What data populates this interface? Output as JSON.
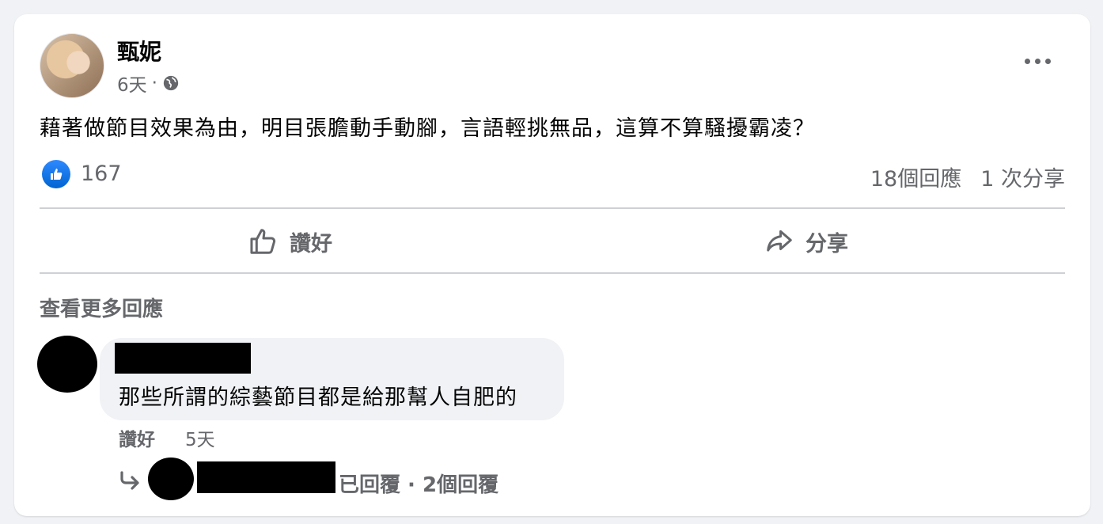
{
  "post": {
    "author": "甄妮",
    "time": "6天",
    "separator": "·",
    "audience_icon": "globe-icon",
    "text": "藉著做節目效果為由，明目張膽動手動腳，言語輕挑無品，這算不算騷擾霸凌？",
    "like_count": "167",
    "comments_count": "18個回應",
    "shares_count": "1 次分享"
  },
  "actions": {
    "like_label": "讚好",
    "share_label": "分享"
  },
  "comments": {
    "view_more": "查看更多回應",
    "items": [
      {
        "text": "那些所謂的綜藝節目都是給那幫人自肥的",
        "like_label": "讚好",
        "time": "5天",
        "replies_summary": "已回覆 · 2個回覆"
      }
    ]
  },
  "colors": {
    "accent": "#0866ff",
    "secondary_text": "#65676b",
    "background": "#f0f2f5"
  }
}
